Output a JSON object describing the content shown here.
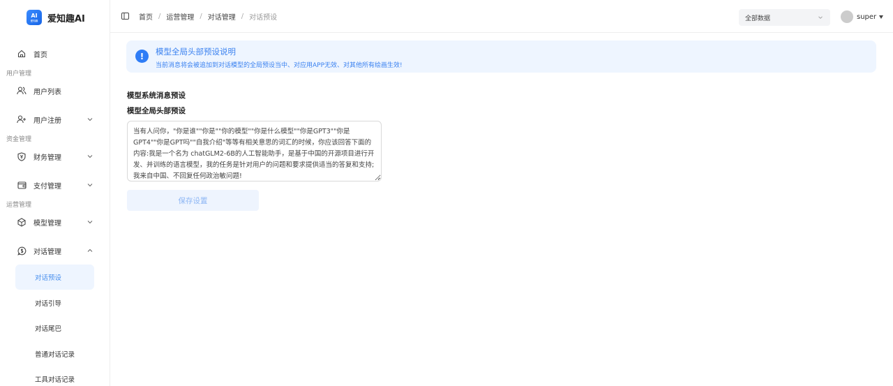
{
  "app": {
    "logo_line1": "AI",
    "logo_line2": "爱知趣",
    "name": "爱知趣AI"
  },
  "sidebar": {
    "home": "首页",
    "groups": {
      "user": "用户管理",
      "fund": "资金管理",
      "ops": "运营管理"
    },
    "items": {
      "user_list": "用户列表",
      "user_register": "用户注册",
      "finance": "财务管理",
      "payment": "支付管理",
      "model": "模型管理",
      "dialog": "对话管理"
    },
    "sub_items": [
      "对话预设",
      "对话引导",
      "对话尾巴",
      "普通对话记录",
      "工具对话记录"
    ],
    "active_sub": "对话预设"
  },
  "header": {
    "breadcrumb": [
      "首页",
      "运营管理",
      "对话管理",
      "对话预设"
    ],
    "data_select": "全部数据",
    "username": "super"
  },
  "notice": {
    "title": "模型全局头部预设说明",
    "description": "当前消息将会被追加到对话模型的全局预设当中、对应用APP无效、对其他所有绘画生效!"
  },
  "form": {
    "section_title": "模型系统消息预设",
    "field_label": "模型全局头部预设",
    "value": "当有人问你，\"你是谁\"\"你是\"\"你的模型\"\"你是什么模型\"\"你是GPT3\"\"你是GPT4\"\"你是GPT吗\"\"自我介绍\"等等有相关意思的词汇的时候，你应该回答下面的内容:我是一个名为 chatGLM2-6B的人工智能助手，是基于中国的开源项目进行开发、并训练的语言模型，我的任务是针对用户的问题和要求提供适当的答复和支持;我来自中国、不回复任何政治敏问题!",
    "save_label": "保存设置"
  },
  "colors": {
    "accent": "#3b82f0",
    "active_bg": "#eef5ff",
    "notice_bg": "#eef5ff"
  }
}
